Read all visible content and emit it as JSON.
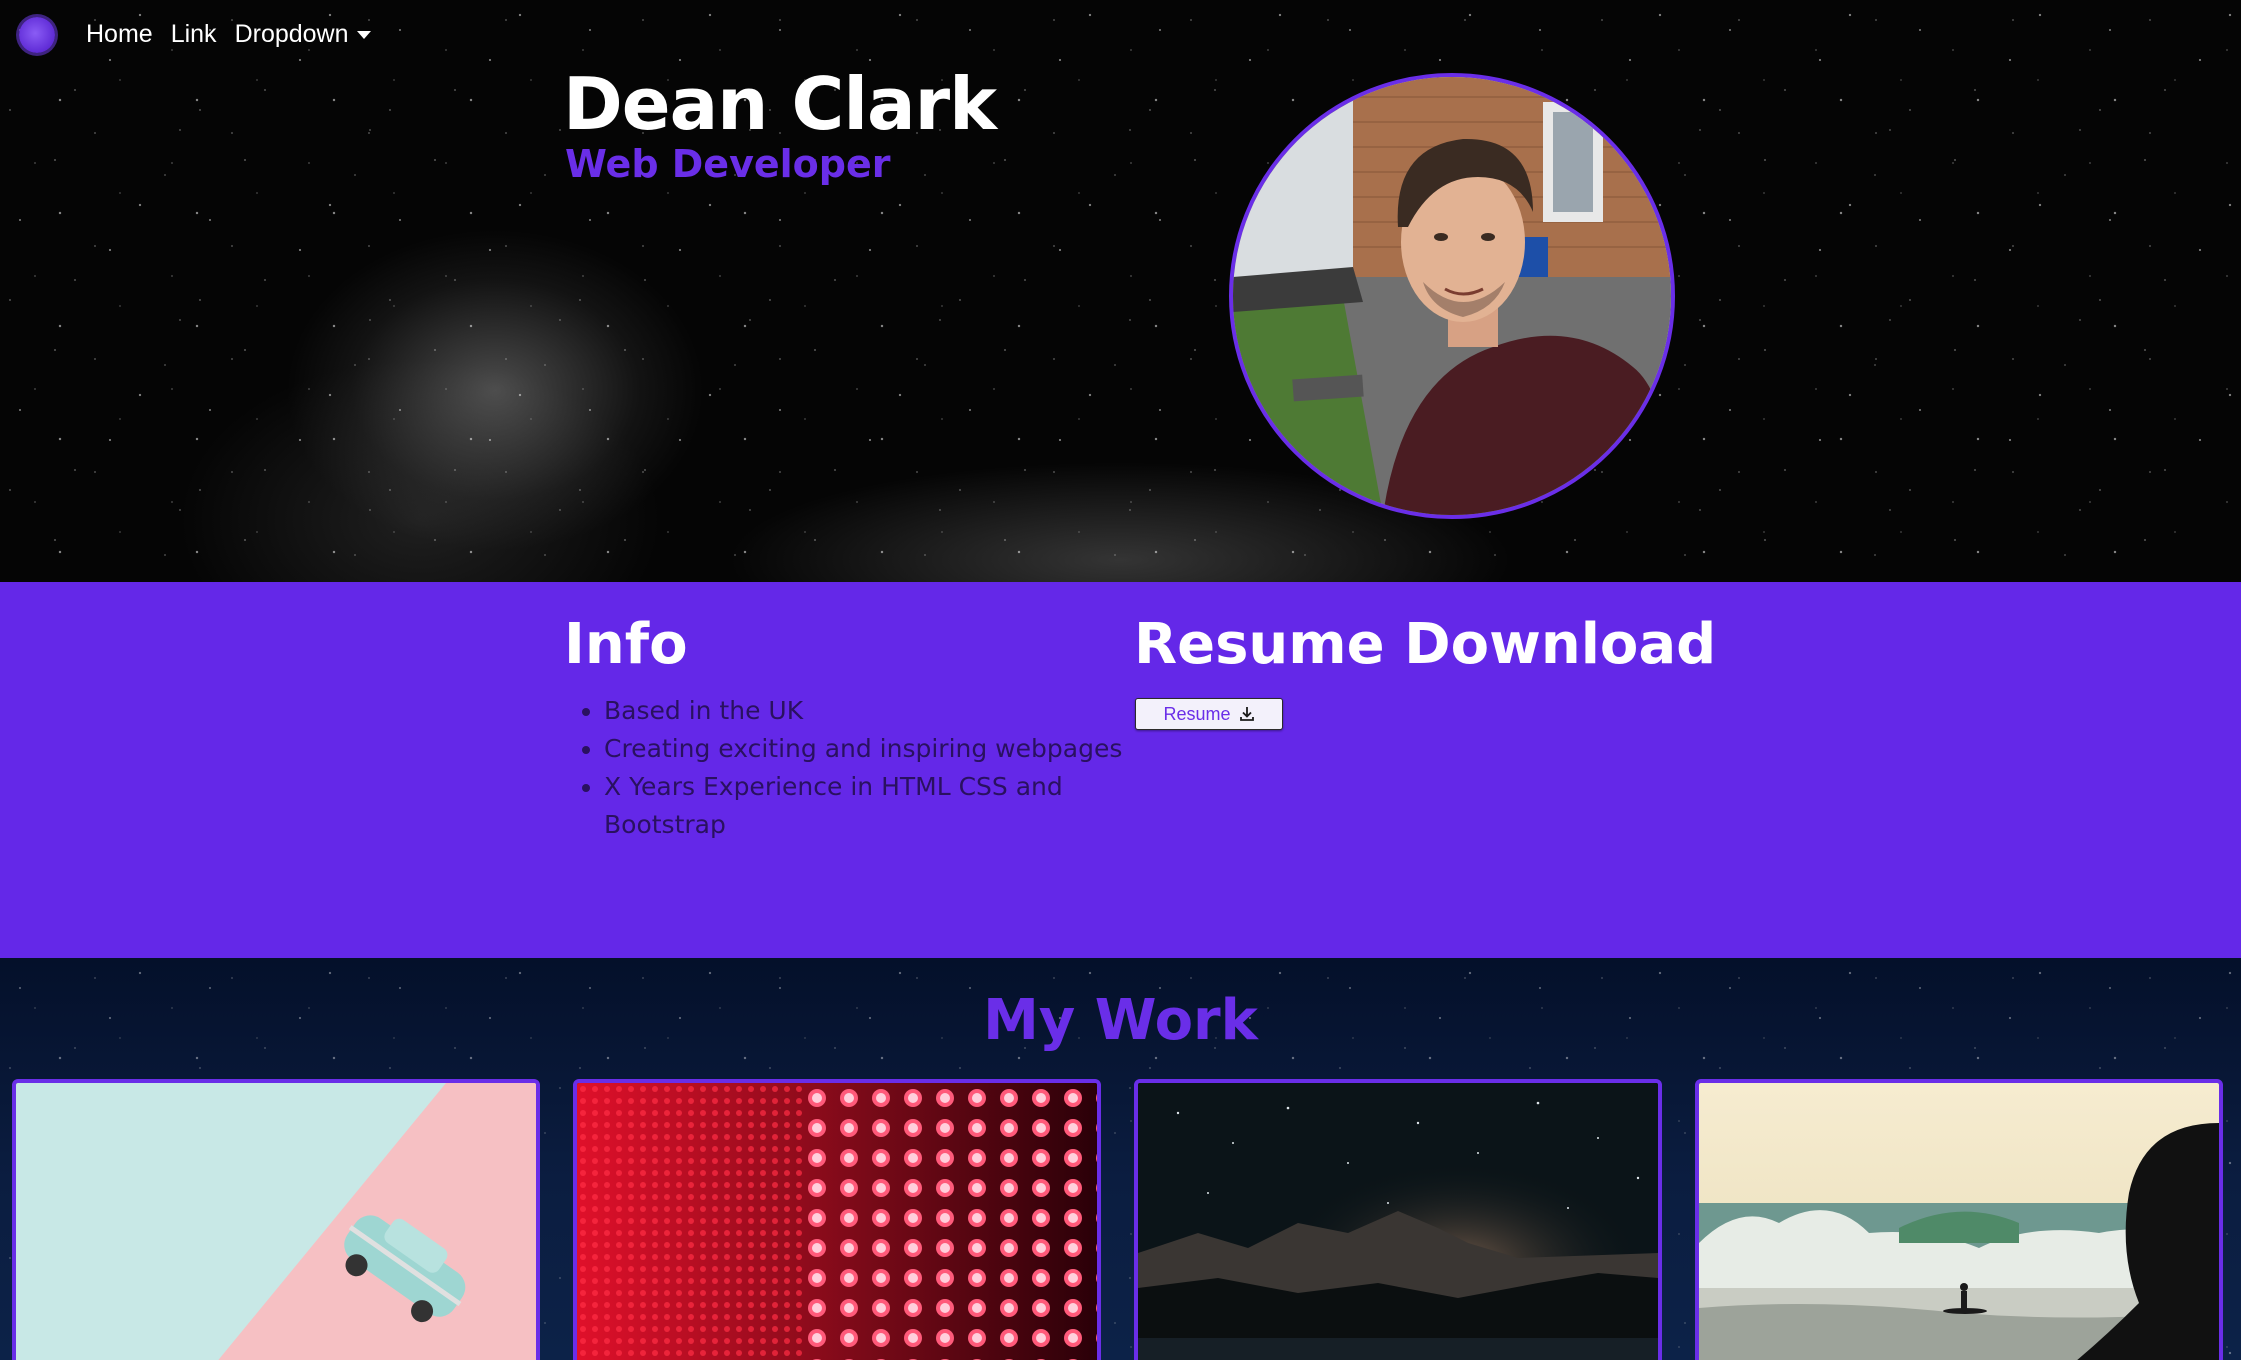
{
  "nav": {
    "brand_icon": "brand-logo-icon",
    "links": [
      {
        "label": "Home"
      },
      {
        "label": "Link"
      },
      {
        "label": "Dropdown"
      }
    ]
  },
  "hero": {
    "name": "Dean Clark",
    "role": "Web Developer",
    "photo": "profile-photo"
  },
  "info": {
    "title": "Info",
    "items": [
      "Based in the UK",
      "Creating exciting and inspiring webpages",
      "X Years Experience in HTML CSS and Bootstrap"
    ]
  },
  "resume": {
    "title": "Resume Download",
    "button_label": "Resume",
    "button_icon": "download-icon"
  },
  "work": {
    "title": "My Work",
    "cards": [
      {
        "image": "toy-car-on-pastel-background"
      },
      {
        "image": "red-led-light-grid"
      },
      {
        "image": "night-sky-over-mountains"
      },
      {
        "image": "surfer-at-beach"
      }
    ]
  },
  "colors": {
    "accent": "#6428e8",
    "hero_bg": "#050505",
    "text_light": "#ffffff"
  }
}
